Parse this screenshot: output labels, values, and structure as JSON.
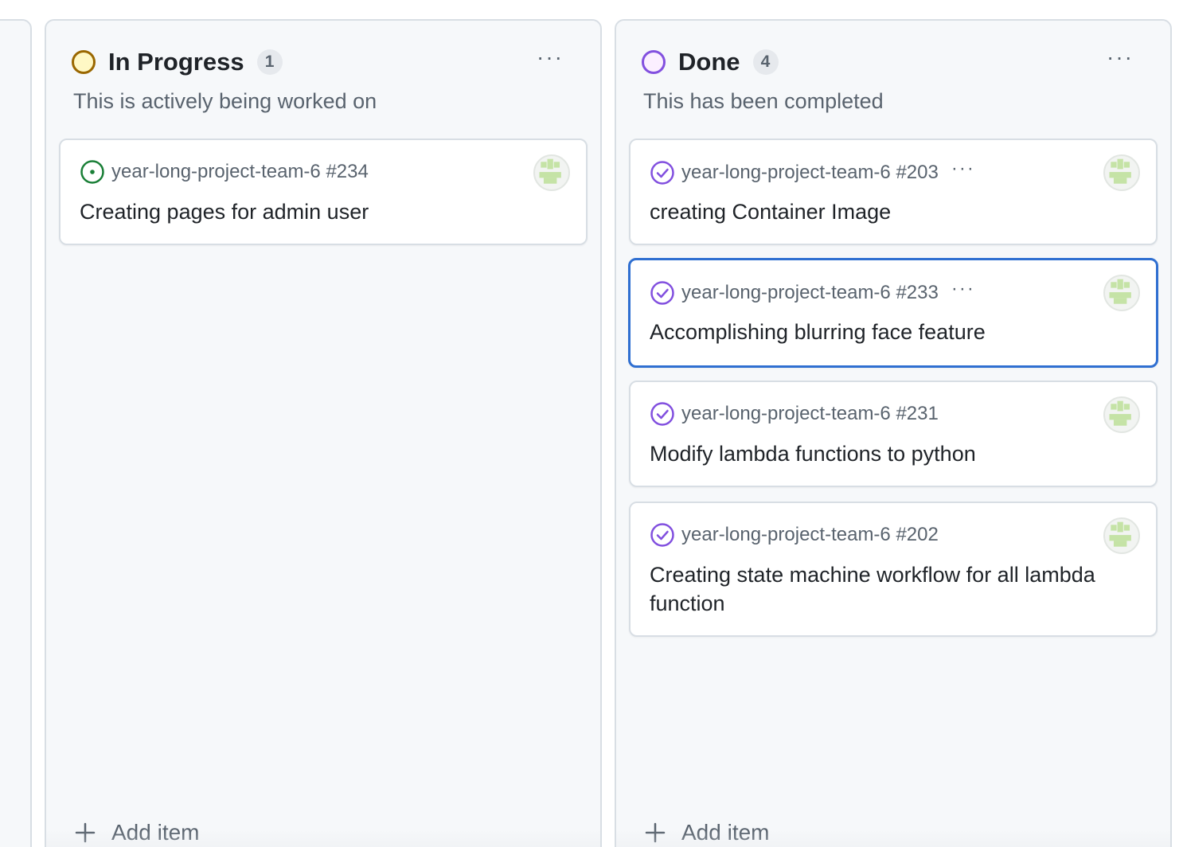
{
  "colors": {
    "in_progress_dot_border": "#9a6700",
    "in_progress_dot_fill": "#fff8c5",
    "done_dot_border": "#8250df",
    "done_dot_fill": "#fbefff",
    "open_issue": "#1a7f37",
    "closed_issue": "#8250df",
    "selected_border": "#2f6fd1"
  },
  "columns": [
    {
      "title": "In Progress",
      "count": "1",
      "description": "This is actively being worked on",
      "menu_icon": "kebab-horizontal-icon",
      "add_item_label": "Add item",
      "cards": [
        {
          "repo_ref": "year-long-project-team-6 #234",
          "title": "Creating pages for admin user",
          "icon": "issue-opened-icon"
        }
      ]
    },
    {
      "title": "Done",
      "count": "4",
      "description": "This has been completed",
      "menu_icon": "kebab-horizontal-icon",
      "add_item_label": "Add item",
      "cards": [
        {
          "repo_ref": "year-long-project-team-6 #203",
          "title": "creating Container Image",
          "icon": "issue-closed-icon"
        },
        {
          "repo_ref": "year-long-project-team-6 #233",
          "title": "Accomplishing blurring face feature",
          "icon": "issue-closed-icon",
          "selected": true
        },
        {
          "repo_ref": "year-long-project-team-6 #231",
          "title": "Modify lambda functions to python",
          "icon": "issue-closed-icon"
        },
        {
          "repo_ref": "year-long-project-team-6 #202",
          "title": "Creating state machine workflow for all lambda function",
          "icon": "issue-closed-icon"
        }
      ]
    }
  ]
}
